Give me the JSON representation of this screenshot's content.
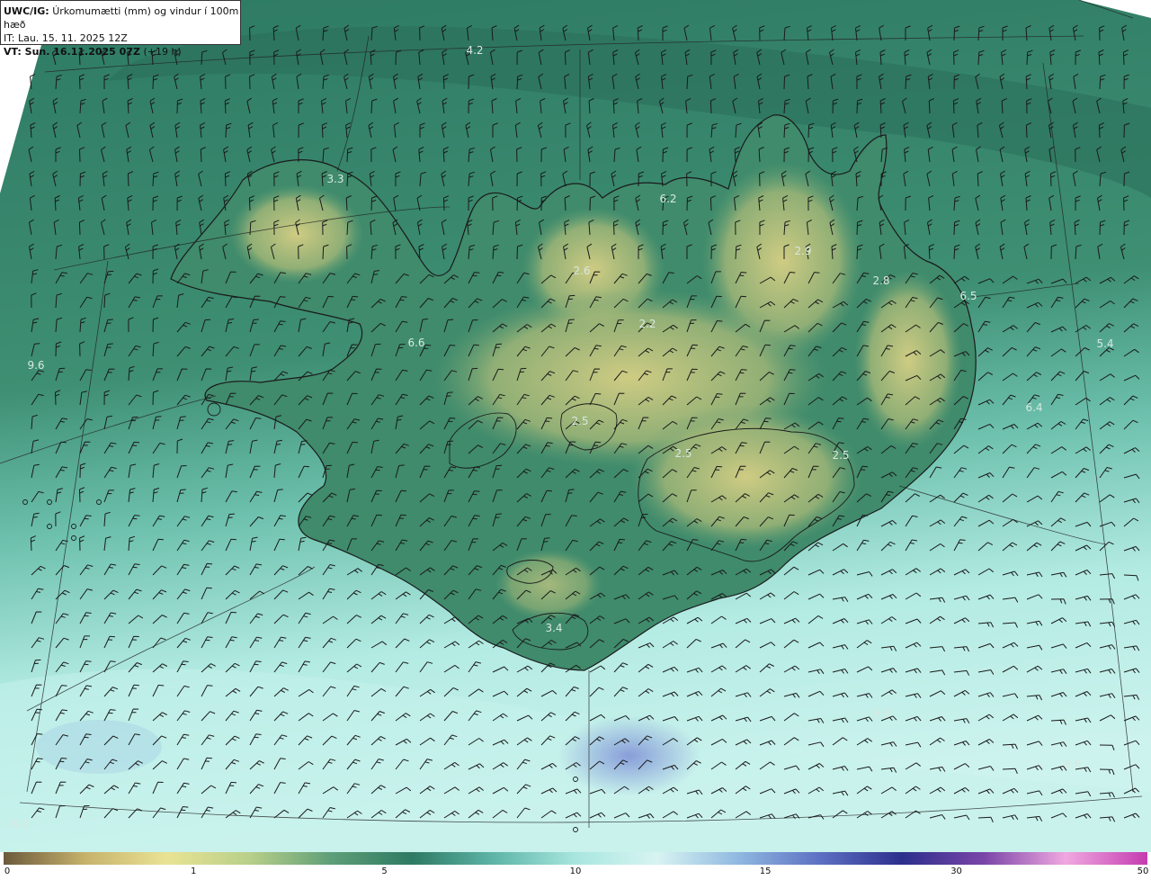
{
  "header": {
    "product": "UWC/IG:",
    "title": "Úrkomumætti (mm) og vindur í 100m hæð",
    "issue_time": "IT: Lau. 15. 11. 2025 12Z",
    "valid_prefix": "VT: Sun. 16.11.2025 07Z",
    "valid_offset": "(+19 h)"
  },
  "colorbar": {
    "ticks": [
      {
        "label": "0",
        "pos": 0.0
      },
      {
        "label": "1",
        "pos": 0.166
      },
      {
        "label": "5",
        "pos": 0.333
      },
      {
        "label": "10",
        "pos": 0.5
      },
      {
        "label": "15",
        "pos": 0.666
      },
      {
        "label": "30",
        "pos": 0.833
      },
      {
        "label": "50",
        "pos": 1.0
      }
    ],
    "colors": [
      "#6b5a3c",
      "#c7b26c",
      "#e9e394",
      "#b9d08a",
      "#5f9f78",
      "#2e7a63",
      "#5eb5a8",
      "#a8e6df",
      "#d8f4f2",
      "#8fb8e0",
      "#5d6fc2",
      "#2c2f8c",
      "#7a45a8",
      "#f0a8e0",
      "#c43cb0"
    ]
  },
  "value_labels": [
    "4.2",
    "3.3",
    "6.2",
    "2.9",
    "2.8",
    "6.5",
    "2.6",
    "2.2",
    "6.6",
    "9.6",
    "5.4",
    "6.4",
    "2.5",
    "2.5",
    "2.5",
    "3.4",
    "9.6",
    "6.6",
    "6.2"
  ],
  "colors": {
    "sea_north": "#2e7a63",
    "sea_south": "#a8e6df",
    "land_low": "#3d8a6a",
    "land_high": "#c6c57e",
    "coastline": "#1a1a1a",
    "barb": "#1a1a1a"
  }
}
